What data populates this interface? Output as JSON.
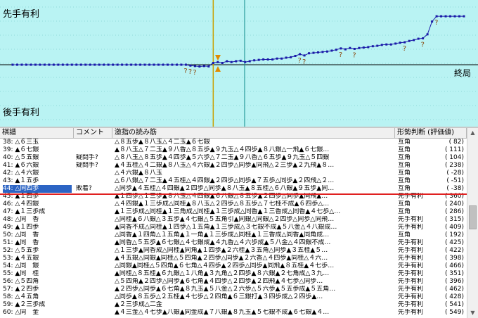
{
  "graph": {
    "top_label": "先手有利",
    "bottom_label": "後手有利",
    "end_label": "終局",
    "bg_color": "#b9f3f3",
    "line_color": "#1a1aa8",
    "marker_color": "#e08a00",
    "question_color": "#8a4a10",
    "chart_data": {
      "type": "line",
      "x": [
        0,
        1,
        2,
        3,
        4,
        5,
        6,
        7,
        8,
        9,
        10,
        11,
        12,
        13,
        14,
        15,
        16,
        17,
        18,
        19,
        20,
        21,
        22,
        23,
        24,
        25,
        26,
        27,
        28,
        29,
        30,
        31,
        32,
        33,
        34,
        35,
        36,
        37,
        38,
        39,
        40,
        41,
        42,
        43,
        44,
        45,
        46,
        47,
        48,
        49,
        50,
        51,
        52,
        53,
        54,
        55,
        56,
        57,
        58,
        59,
        60,
        61,
        62,
        63,
        64,
        65,
        66,
        67,
        68,
        69,
        70,
        71,
        72,
        73,
        74,
        75,
        76,
        77,
        78,
        79,
        80,
        81,
        82,
        83,
        84,
        85,
        86,
        87,
        88,
        89,
        90,
        91,
        92,
        93,
        94,
        95,
        96,
        97,
        98,
        99
      ],
      "values": [
        0,
        0,
        0,
        0,
        0,
        0,
        0,
        0,
        0,
        0,
        0,
        0,
        0,
        0,
        0,
        0,
        0,
        0,
        0,
        0,
        0,
        0,
        0,
        0,
        0,
        0,
        0,
        0,
        0,
        0,
        0,
        0,
        0,
        0,
        0,
        0,
        0,
        0,
        0,
        -20,
        -30,
        -40,
        -30,
        -38,
        40,
        60,
        40,
        80,
        60,
        80,
        90,
        60,
        80,
        100,
        110,
        120,
        120,
        120,
        140,
        140,
        160,
        170,
        200,
        240,
        210,
        260,
        270,
        280,
        290,
        300,
        320,
        340,
        370,
        350,
        380,
        360,
        380,
        390,
        400,
        420,
        430,
        450,
        460,
        460,
        480,
        500,
        510,
        540,
        560,
        590,
        600,
        690,
        980,
        1100,
        1100,
        1100,
        1100,
        1100,
        1100,
        1100
      ],
      "ylim": [
        -1100,
        1150
      ],
      "current_move": 44
    },
    "question_marks": [
      38,
      39,
      40,
      63,
      64,
      72,
      75,
      86,
      90,
      93
    ]
  },
  "table": {
    "headers": [
      "棋譜",
      "コメント",
      "激指の読み筋",
      "形勢判断 (評価値)"
    ],
    "rows": [
      {
        "move": "38: △６三玉",
        "comment": "",
        "line": "△８五歩▲８八玉△４二玉▲６七銀",
        "judge": "互角",
        "val": "(  82)"
      },
      {
        "move": "39: ▲６七銀",
        "comment": "",
        "line": "▲８八玉△７二玉▲９八香△８五歩▲９九玉△４四歩▲８八銀△一飛▲６七銀…",
        "judge": "互角",
        "val": "( 111)"
      },
      {
        "move": "40: △５五銀",
        "comment": "疑問手?",
        "line": "△８八玉△８五歩▲４四歩▲５六歩△７二玉▲９八香△６五歩▲９九玉△５四銀",
        "judge": "互角",
        "val": "( 104)"
      },
      {
        "move": "41: ▲６六銀",
        "comment": "疑問手?",
        "line": "▲４五桂△４二銀▲８八玉△４六銀▲２四歩△同歩▲同飛△２三歩▲２九飛▲８…",
        "judge": "互角",
        "val": "( 238)"
      },
      {
        "move": "42: △４六銀",
        "comment": "",
        "line": "△４六銀▲８八玉",
        "judge": "互角",
        "val": "( -28)"
      },
      {
        "move": "43: ▲１五歩",
        "comment": "",
        "line": "△６八銀△７二玉▲４五桂△４四銀▲２四歩△同歩▲７五歩△同歩▲２四飛△２…",
        "judge": "互角",
        "val": "( -51)"
      },
      {
        "move": "44: △同四歩",
        "comment": "敗着?",
        "line": "△同歩▲４五桂△４四銀▲２四歩△同歩▲８八玉▲８五桂△６八銀▲９五歩▲同…",
        "judge": "互角",
        "val": "( -38)",
        "sel": true
      },
      {
        "move": "45: ▲１四歩",
        "comment": "",
        "line": "▲１四歩△１三歩▲８八玉△４四銀▲６八銀△８五歩▲２四歩△同歩▲同飛▲…",
        "judge": "先手有利",
        "val": "( 360)"
      },
      {
        "move": "46: △４四銀",
        "comment": "",
        "line": "△４四銀▲１三歩成△同桂▲８八玉△２四歩△８五歩△７七桂不成▲６四歩△…",
        "judge": "互角",
        "val": "( 240)"
      },
      {
        "move": "47: ▲１三歩成",
        "comment": "",
        "line": "▲１三歩成△同桂▲１三角成△同桂▲１三歩成△同香▲１三香成△同香▲４七歩△…",
        "judge": "互角",
        "val": "( 286)"
      },
      {
        "move": "48: △同　香",
        "comment": "",
        "line": "△同桂▲６八銀△３五歩▲４七銀△５五角引▲同銀△同銀△２四歩△同歩△同飛…",
        "judge": "先手有利",
        "val": "( 315)"
      },
      {
        "move": "49: ▲１四歩",
        "comment": "",
        "line": "▲同香不成△同桂▲１四歩△１五角▲１三歩成△３七銀不成▲５八金△４八銀成…",
        "judge": "先手有利",
        "val": "( 409)"
      },
      {
        "move": "50: △同　香",
        "comment": "",
        "line": "△同香▲１四角△１五角▲１一角▲１三歩成△同桂▲１三香成△同香▲同角成…",
        "judge": "互角",
        "val": "( 192)"
      },
      {
        "move": "51: ▲同　香",
        "comment": "",
        "line": "▲同香△５五歩▲６七銀△４七銀成▲４九香△４六歩成▲５八金△４四銀不成…",
        "judge": "先手有利",
        "val": "( 425)"
      },
      {
        "move": "52: △５五歩",
        "comment": "",
        "line": "△１三歩▲同香成△同桂▲同角▲１四歩▲２六桂▲３五角△同歩▲３五桂▲５…",
        "judge": "先手有利",
        "val": "( 422)"
      },
      {
        "move": "53: ▲４五銀",
        "comment": "",
        "line": "▲４五銀△同銀▲同桂△５四角▲２四歩△同歩▲２六香△４四歩▲同桂△４六…",
        "judge": "先手有利",
        "val": "( 398)"
      },
      {
        "move": "54: △同　銀",
        "comment": "",
        "line": "△同銀▲同桂△５四角▲６七角△４四歩▲２四歩△同歩▲同飛▲８五桂▲４七歩…",
        "judge": "先手有利",
        "val": "( 466)"
      },
      {
        "move": "55: ▲同　桂",
        "comment": "",
        "line": "▲同桂△８五桂▲６九銀△１八角▲３九角△２四歩▲８六銀▲２七角成△３九…",
        "judge": "先手有利",
        "val": "( 351)"
      },
      {
        "move": "56: △５四角",
        "comment": "",
        "line": "△５四角▲２四歩△同歩▲６七角▲４四歩△２四歩▲２四飛▲４七歩△同歩…",
        "judge": "先手有利",
        "val": "( 396)"
      },
      {
        "move": "57: ▲２四歩",
        "comment": "",
        "line": "▲２四歩△同歩▲６七角▲８九玉▲５八金△２六歩△５六歩▲５五歩成▲５五角…",
        "judge": "先手有利",
        "val": "( 462)"
      },
      {
        "move": "58: △４五角",
        "comment": "",
        "line": "△同歩▲８五歩△２五桂▲４七歩△２四角▲６三銀打▲３四歩成△２四歩▲…",
        "judge": "先手有利",
        "val": "( 428)"
      },
      {
        "move": "59: ▲２三歩成",
        "comment": "",
        "line": "▲２三歩成△二金",
        "judge": "先手有利",
        "val": "( 541)"
      },
      {
        "move": "60: △同　金",
        "comment": "",
        "line": "▲４三金△４七歩▲八銀▲同金成▲７八銀▲８九玉▲５七銀不成▲６七銀▲４…",
        "judge": "先手有利",
        "val": "( 549)"
      }
    ]
  }
}
